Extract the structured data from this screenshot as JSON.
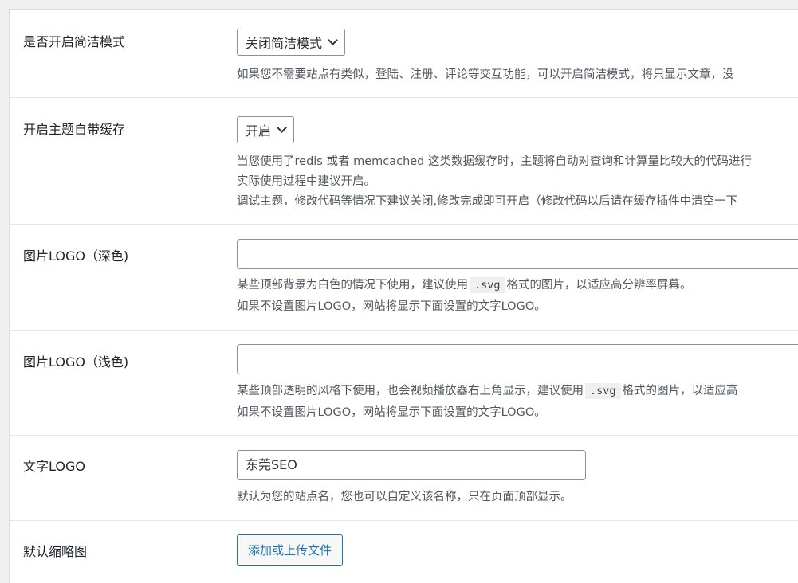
{
  "rows": [
    {
      "label": "是否开启简洁模式",
      "select_value": "关闭简洁模式",
      "desc": [
        "如果您不需要站点有类似，登陆、注册、评论等交互功能，可以开启简洁模式，将只显示文章，没"
      ]
    },
    {
      "label": "开启主题自带缓存",
      "select_value": "开启",
      "desc": [
        "当您使用了redis 或者 memcached 这类数据缓存时，主题将自动对查询和计算量比较大的代码进行",
        "实际使用过程中建议开启。",
        "调试主题，修改代码等情况下建议关闭,修改完成即可开启（修改代码以后请在缓存插件中清空一下"
      ]
    },
    {
      "label": "图片LOGO（深色)",
      "input_value": "",
      "desc_a_before": "某些顶部背景为白色的情况下使用，建议使用",
      "desc_a_code": ".svg",
      "desc_a_after": "格式的图片，以适应高分辨率屏幕。",
      "desc_b": "如果不设置图片LOGO，网站将显示下面设置的文字LOGO。"
    },
    {
      "label": "图片LOGO（浅色)",
      "input_value": "",
      "desc_a_before": "某些顶部透明的风格下使用，也会视频播放器右上角显示，建议使用",
      "desc_a_code": ".svg",
      "desc_a_after": "格式的图片，以适应高",
      "desc_b": "如果不设置图片LOGO，网站将显示下面设置的文字LOGO。"
    },
    {
      "label": "文字LOGO",
      "input_value": "东莞SEO",
      "desc": [
        "默认为您的站点名，您也可以自定义该名称，只在页面顶部显示。"
      ]
    },
    {
      "label": "默认缩略图",
      "button_label": "添加或上传文件"
    }
  ]
}
